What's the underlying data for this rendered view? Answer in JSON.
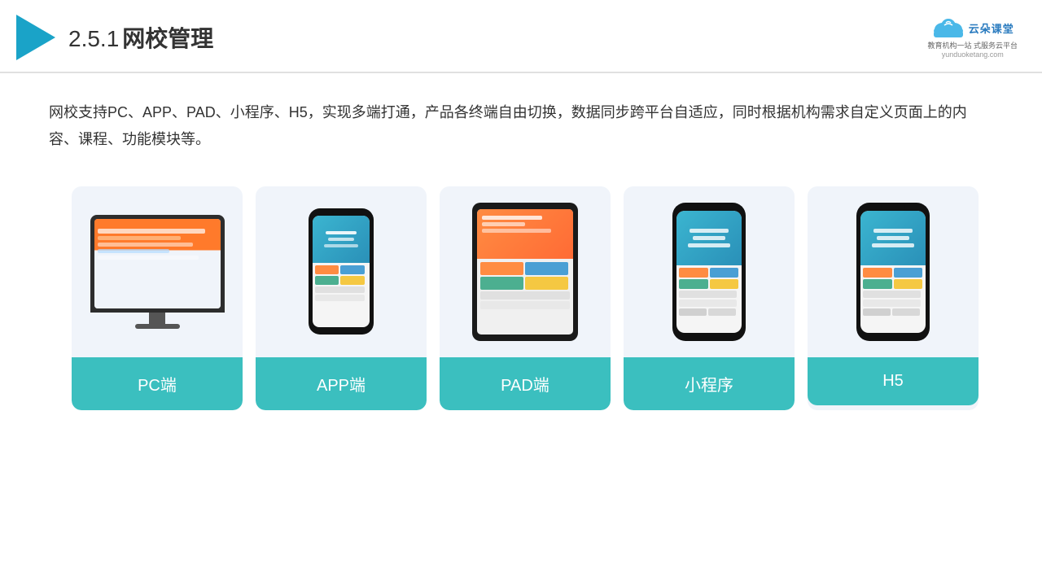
{
  "header": {
    "section_number": "2.5.1",
    "title": "网校管理",
    "brand": {
      "name": "云朵课堂",
      "url": "yunduoketang.com",
      "tagline": "教育机构一站\n式服务云平台"
    }
  },
  "description": "网校支持PC、APP、PAD、小程序、H5，实现多端打通，产品各终端自由切换，数据同步跨平台自适应，同时根据机构需求自定义页面上的内容、课程、功能模块等。",
  "cards": [
    {
      "id": "pc",
      "label": "PC端"
    },
    {
      "id": "app",
      "label": "APP端"
    },
    {
      "id": "pad",
      "label": "PAD端"
    },
    {
      "id": "mini",
      "label": "小程序"
    },
    {
      "id": "h5",
      "label": "H5"
    }
  ]
}
